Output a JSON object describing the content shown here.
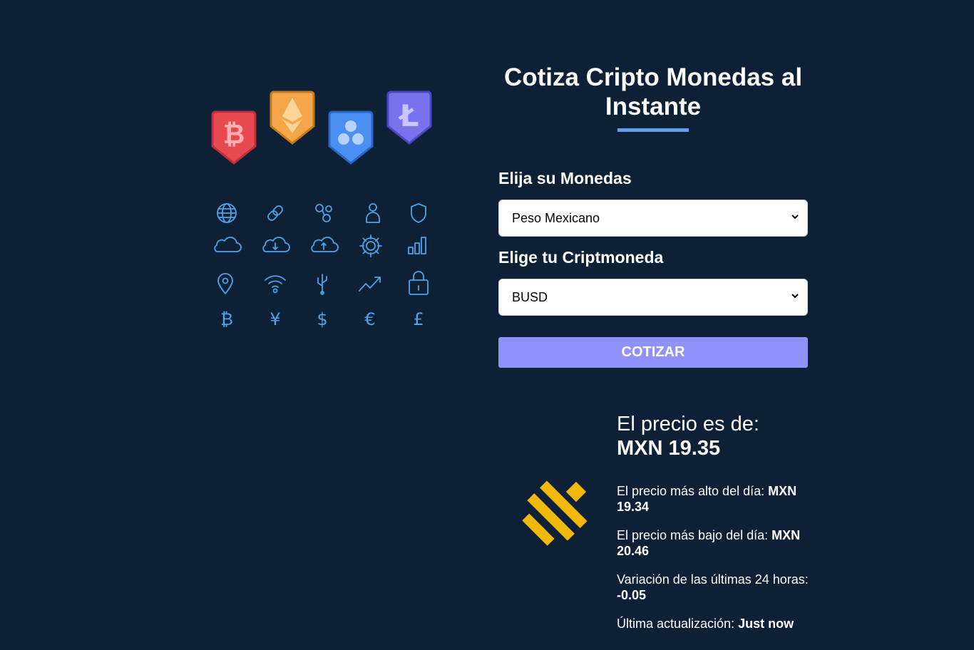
{
  "header": {
    "title": "Cotiza Cripto Monedas al Instante"
  },
  "form": {
    "currency_label": "Elija su Monedas",
    "currency_selected": "Peso Mexicano",
    "crypto_label": "Elige tu Criptmoneda",
    "crypto_selected": "BUSD",
    "submit_label": "COTIZAR"
  },
  "hero": {
    "badges": [
      {
        "name": "bitcoin-badge-icon",
        "color": "#e8484f"
      },
      {
        "name": "ethereum-badge-icon",
        "color": "#f59a3c"
      },
      {
        "name": "ripple-badge-icon",
        "color": "#3f88f0"
      },
      {
        "name": "litecoin-badge-icon",
        "color": "#6e6ae8"
      }
    ],
    "grid_icons": [
      "globe-icon",
      "link-icon",
      "nodes-icon",
      "user-icon",
      "shield-icon",
      "cloud-icon",
      "cloud-download-icon",
      "cloud-upload-icon",
      "gear-icon",
      "bar-chart-icon",
      "map-pin-icon",
      "wifi-icon",
      "usb-icon",
      "trend-up-icon",
      "lock-icon",
      "bitcoin-icon",
      "yen-icon",
      "dollar-icon",
      "euro-icon",
      "pound-icon"
    ]
  },
  "result": {
    "price_label": "El precio es de:",
    "price_value": "MXN 19.35",
    "high_label": "El precio más alto del día:",
    "high_value": "MXN 19.34",
    "low_label": "El precio más bajo del día:",
    "low_value": "MXN 20.46",
    "change_label": "Variación de las últimas 24 horas:",
    "change_value": "-0.05",
    "updated_label": "Última actualización:",
    "updated_value": "Just now",
    "coin_icon": "busd-logo-icon",
    "coin_color": "#f0b90b"
  },
  "colors": {
    "background": "#0d2035",
    "accent_bar": "#5fa0e8",
    "button": "#8f92fb",
    "line_icons": "#4fa3e8"
  }
}
